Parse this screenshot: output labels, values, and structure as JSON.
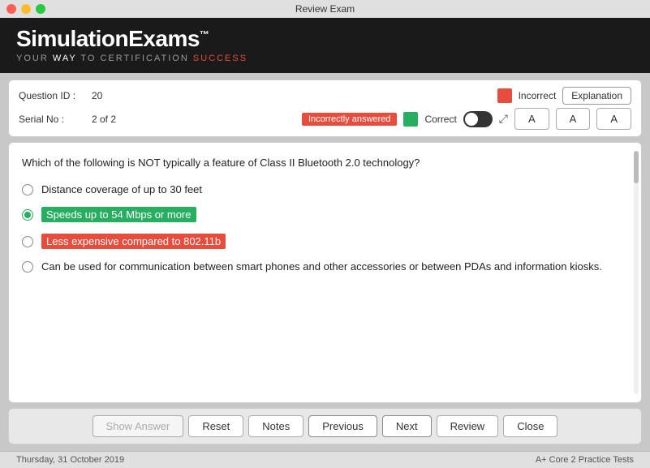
{
  "titleBar": {
    "title": "Review Exam"
  },
  "header": {
    "title": "SimulationExams",
    "trademark": "™",
    "subtitle_before": "YOUR ",
    "subtitle_way": "WAY",
    "subtitle_middle": " TO CERTIFICATION ",
    "subtitle_success": "SUCCESS"
  },
  "infoPanel": {
    "questionIdLabel": "Question ID :",
    "questionIdValue": "20",
    "serialNoLabel": "Serial No :",
    "serialNoValue": "2 of 2",
    "incorrectBadge": "Incorrectly answered",
    "incorrectLabel": "Incorrect",
    "correctLabel": "Correct",
    "explanationBtn": "Explanation",
    "fontA": "A",
    "fontA2": "A",
    "fontA3": "A"
  },
  "question": {
    "text": "Which of the following is NOT typically a feature of Class II Bluetooth 2.0 technology?",
    "options": [
      {
        "id": 1,
        "text": "Distance coverage of up to 30 feet",
        "state": "normal",
        "selected": false
      },
      {
        "id": 2,
        "text": "Speeds up to 54 Mbps or more",
        "state": "correct",
        "selected": true
      },
      {
        "id": 3,
        "text": "Less expensive compared to 802.11b",
        "state": "wrong",
        "selected": false
      },
      {
        "id": 4,
        "text": "Can be used for communication between smart phones and other accessories or between PDAs and information kiosks.",
        "state": "normal",
        "selected": false
      }
    ]
  },
  "bottomBar": {
    "showAnswerBtn": "Show Answer",
    "resetBtn": "Reset",
    "notesBtn": "Notes",
    "previousBtn": "Previous",
    "nextBtn": "Next",
    "reviewBtn": "Review",
    "closeBtn": "Close"
  },
  "footer": {
    "date": "Thursday, 31 October 2019",
    "product": "A+ Core 2 Practice Tests"
  }
}
